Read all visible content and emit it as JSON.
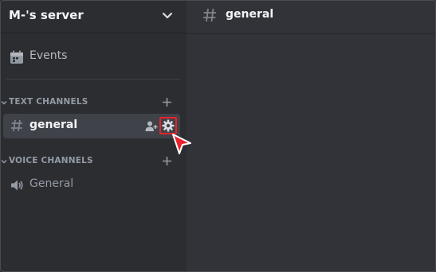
{
  "server": {
    "name": "M-'s server"
  },
  "sidebar": {
    "events_label": "Events",
    "categories": [
      {
        "label": "TEXT CHANNELS"
      },
      {
        "label": "VOICE CHANNELS"
      }
    ],
    "text_channels": [
      {
        "label": "general",
        "selected": true
      }
    ],
    "voice_channels": [
      {
        "label": "General"
      }
    ]
  },
  "chat_header": {
    "channel_name": "general"
  },
  "colors": {
    "sidebar_bg": "#2b2d31",
    "main_bg": "#313338",
    "selected_row": "#404249",
    "highlight": "#e8232a"
  },
  "icons": [
    "chevron-down-icon",
    "calendar-icon",
    "hash-icon",
    "plus-icon",
    "invite-icon",
    "gear-icon",
    "speaker-icon",
    "cursor-icon"
  ]
}
